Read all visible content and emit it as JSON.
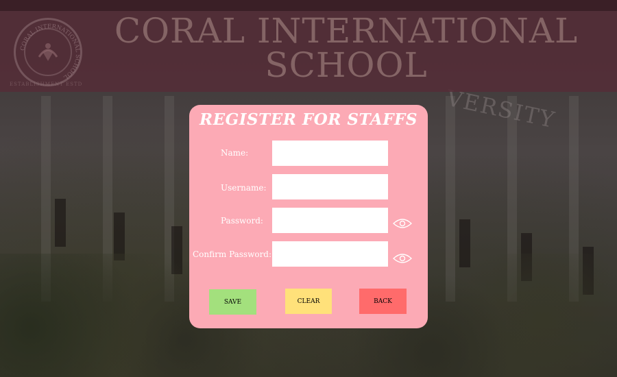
{
  "header": {
    "school_name": "CORAL INTERNATIONAL SCHOOL",
    "logo_ring_text": "CORAL INTERNATIONAL SCHOOL",
    "logo_caption": "ESTABLISHMENT ESTD"
  },
  "background": {
    "building_text": "VERSITY"
  },
  "form": {
    "title": "REGISTER FOR STAFFS",
    "fields": {
      "name": {
        "label": "Name:",
        "value": "",
        "placeholder": ""
      },
      "username": {
        "label": "Username:",
        "value": "",
        "placeholder": ""
      },
      "password": {
        "label": "Password:",
        "value": "",
        "placeholder": ""
      },
      "confirm_password": {
        "label": "Confirm Password:",
        "value": "",
        "placeholder": ""
      }
    },
    "buttons": {
      "save": "SAVE",
      "clear": "CLEAR",
      "back": "BACK"
    },
    "icons": {
      "password_toggle": "eye-icon",
      "confirm_password_toggle": "eye-icon"
    }
  },
  "colors": {
    "card_bg": "#fcaab5",
    "save_button": "#a3e07d",
    "clear_button": "#ffe17a",
    "back_button": "#ff6b6b",
    "header_bg": "#552d37"
  }
}
